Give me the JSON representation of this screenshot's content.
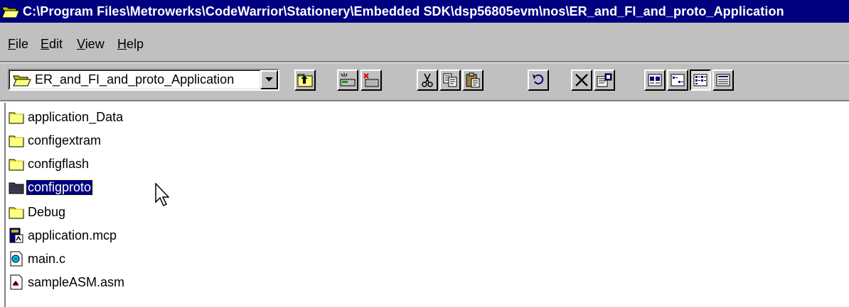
{
  "window": {
    "title": "C:\\Program Files\\Metrowerks\\CodeWarrior\\Stationery\\Embedded SDK\\dsp56805evm\\nos\\ER_and_FI_and_proto_Application",
    "icon": "folder-open-icon"
  },
  "menu": [
    {
      "label": "File",
      "icon": ""
    },
    {
      "label": "Edit",
      "icon": ""
    },
    {
      "label": "View",
      "icon": ""
    },
    {
      "label": "Help",
      "icon": ""
    }
  ],
  "toolbar": {
    "address_value": "ER_and_FI_and_proto_Application",
    "address_icon": "folder-open-icon",
    "buttons": [
      {
        "name": "up-one-level-button",
        "icon": "up-folder-icon"
      },
      {
        "name": "map-drive-button",
        "icon": "map-drive-icon"
      },
      {
        "name": "disconnect-drive-button",
        "icon": "disconnect-drive-icon"
      },
      {
        "name": "cut-button",
        "icon": "scissors-icon"
      },
      {
        "name": "copy-button",
        "icon": "copy-icon"
      },
      {
        "name": "paste-button",
        "icon": "paste-icon"
      },
      {
        "name": "undo-button",
        "icon": "undo-icon"
      },
      {
        "name": "delete-button",
        "icon": "delete-x-icon"
      },
      {
        "name": "properties-button",
        "icon": "properties-icon"
      },
      {
        "name": "large-icons-button",
        "icon": "large-icons-icon"
      },
      {
        "name": "small-icons-button",
        "icon": "small-icons-icon"
      },
      {
        "name": "list-button",
        "icon": "list-view-icon",
        "active": true
      },
      {
        "name": "details-button",
        "icon": "details-view-icon"
      }
    ]
  },
  "files": [
    {
      "label": "application_Data",
      "icon": "folder-icon",
      "selected": false
    },
    {
      "label": "configextram",
      "icon": "folder-icon",
      "selected": false
    },
    {
      "label": "configflash",
      "icon": "folder-icon",
      "selected": false
    },
    {
      "label": "configproto",
      "icon": "folder-icon",
      "selected": true
    },
    {
      "label": "Debug",
      "icon": "folder-icon",
      "selected": false
    },
    {
      "label": "application.mcp",
      "icon": "mcp-project-icon",
      "selected": false
    },
    {
      "label": "main.c",
      "icon": "c-source-icon",
      "selected": false
    },
    {
      "label": "sampleASM.asm",
      "icon": "asm-file-icon",
      "selected": false
    }
  ],
  "colors": {
    "titlebar": "#000080",
    "chrome": "#c0c0c0",
    "selection": "#000080",
    "folder": "#ffff80"
  }
}
